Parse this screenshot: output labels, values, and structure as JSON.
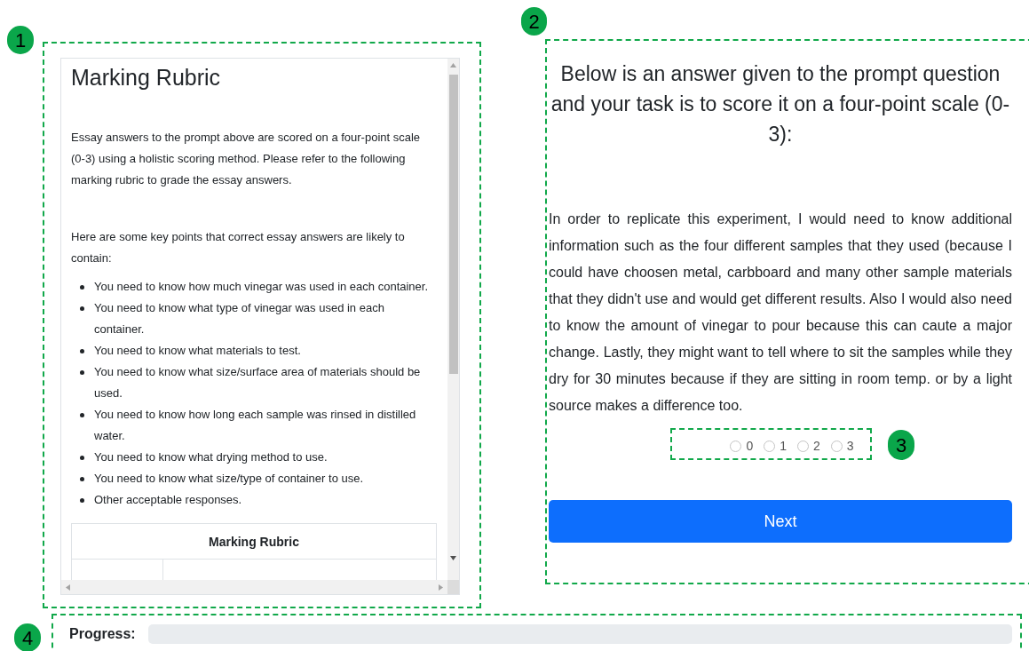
{
  "rubric": {
    "title": "Marking Rubric",
    "intro": "Essay answers to the prompt above are scored on a four-point scale (0-3) using a holistic scoring method. Please refer to the following marking rubric to grade the essay answers.",
    "key_points_intro": "Here are some key points that correct essay answers are likely to contain:",
    "key_points": [
      "You need to know how much vinegar was used in each container.",
      "You need to know what type of vinegar was used in each container.",
      "You need to know what materials to test.",
      "You need to know what size/surface area of materials should be used.",
      "You need to know how long each sample was rinsed in distilled water.",
      "You need to know what drying method to use.",
      "You need to know what size/type of container to use.",
      "Other acceptable responses."
    ],
    "table_header": "Marking Rubric"
  },
  "prompt": {
    "heading": "Below is an answer given to the prompt question and your task is to score it on a four-point scale (0-3):",
    "answer": "In order to replicate this experiment, I would need to know additional information such as the four different samples that they used (because I could have choosen metal, carbboard and many other sample materials that they didn't use and would get different results. Also I would also need to know the amount of vinegar to pour because this can caute a major change. Lastly, they might want to tell where to sit the samples while they dry for 30 minutes because if they are sitting in room temp. or by a light source makes a difference too."
  },
  "score_options": [
    {
      "label": "0",
      "selected": false
    },
    {
      "label": "1",
      "selected": false
    },
    {
      "label": "2",
      "selected": false
    },
    {
      "label": "3",
      "selected": false
    }
  ],
  "next_button": "Next",
  "progress": {
    "label": "Progress:",
    "level": 0
  },
  "callouts": [
    {
      "number": "1"
    },
    {
      "number": "2"
    },
    {
      "number": "3"
    },
    {
      "number": "4"
    }
  ]
}
